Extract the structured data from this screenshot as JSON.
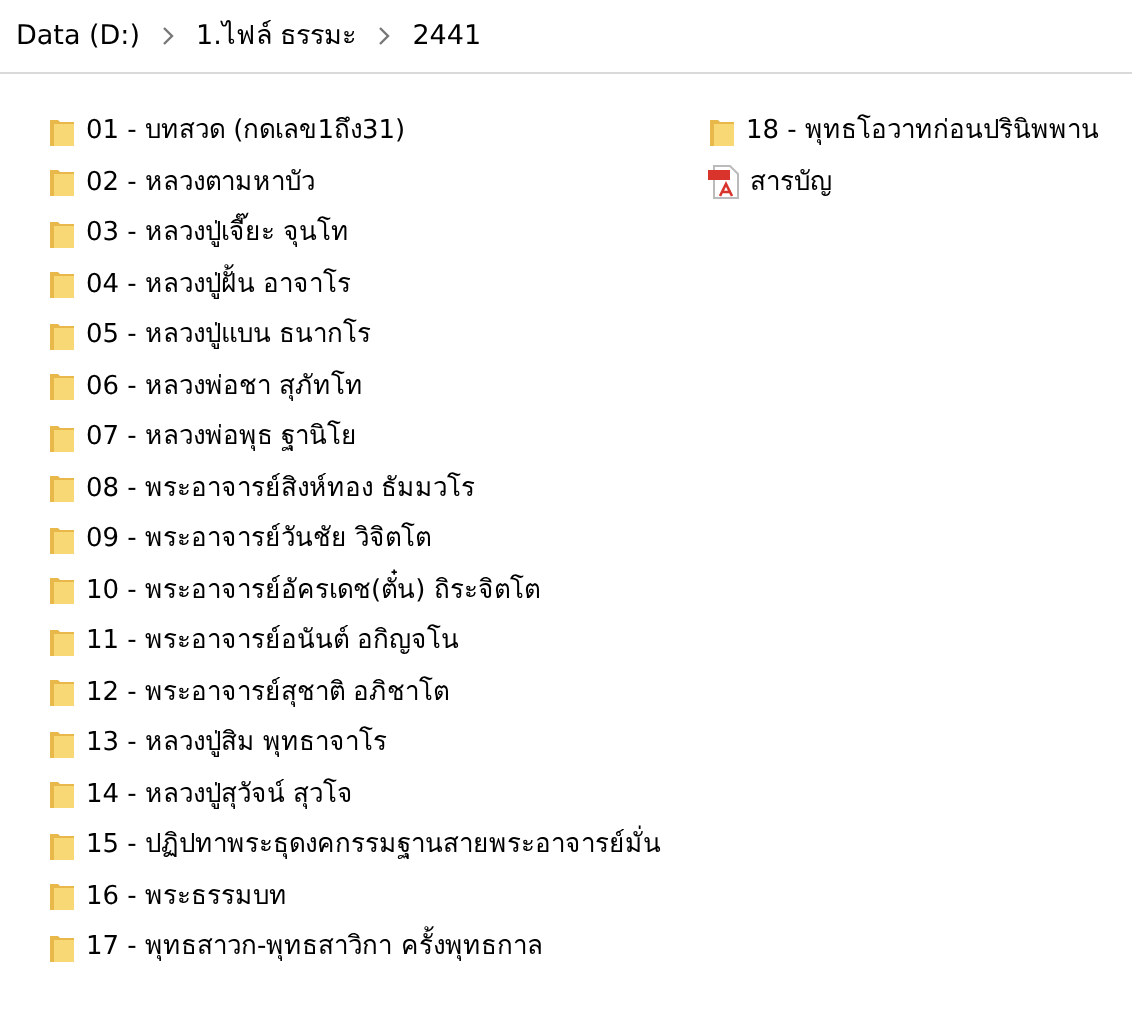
{
  "breadcrumb": [
    "Data (D:)",
    "1.ไฟล์ ธรรมะ",
    "2441"
  ],
  "items": [
    {
      "kind": "folder",
      "name": "01 - บทสวด (กดเลข1ถึง31)"
    },
    {
      "kind": "folder",
      "name": "02 - หลวงตามหาบัว"
    },
    {
      "kind": "folder",
      "name": "03 - หลวงปู่เจี๊ยะ  จุนโท"
    },
    {
      "kind": "folder",
      "name": "04 - หลวงปู่ฝั้น  อาจาโร"
    },
    {
      "kind": "folder",
      "name": "05 - หลวงปู่แบน  ธนากโร"
    },
    {
      "kind": "folder",
      "name": "06 - หลวงพ่อชา  สุภัทโท"
    },
    {
      "kind": "folder",
      "name": "07 - หลวงพ่อพุธ  ฐานิโย"
    },
    {
      "kind": "folder",
      "name": "08 - พระอาจารย์สิงห์ทอง  ธัมมวโร"
    },
    {
      "kind": "folder",
      "name": "09 - พระอาจารย์วันชัย  วิจิตโต"
    },
    {
      "kind": "folder",
      "name": "10 - พระอาจารย์อัครเดช(ตั๋น)  ถิระจิตโต"
    },
    {
      "kind": "folder",
      "name": "11 - พระอาจารย์อนันต์  อกิญจโน"
    },
    {
      "kind": "folder",
      "name": "12 - พระอาจารย์สุชาติ  อภิชาโต"
    },
    {
      "kind": "folder",
      "name": "13 - หลวงปู่สิม  พุทธาจาโร"
    },
    {
      "kind": "folder",
      "name": "14 - หลวงปู่สุวัจน์  สุวโจ"
    },
    {
      "kind": "folder",
      "name": "15 - ปฏิปทาพระธุดงคกรรมฐานสายพระอาจารย์มั่น"
    },
    {
      "kind": "folder",
      "name": "16 - พระธรรมบท"
    },
    {
      "kind": "folder",
      "name": "17 - พุทธสาวก-พุทธสาวิกา ครั้งพุทธกาล"
    },
    {
      "kind": "folder",
      "name": "18 - พุทธโอวาทก่อนปรินิพพาน"
    },
    {
      "kind": "pdf",
      "name": "สารบัญ"
    }
  ]
}
